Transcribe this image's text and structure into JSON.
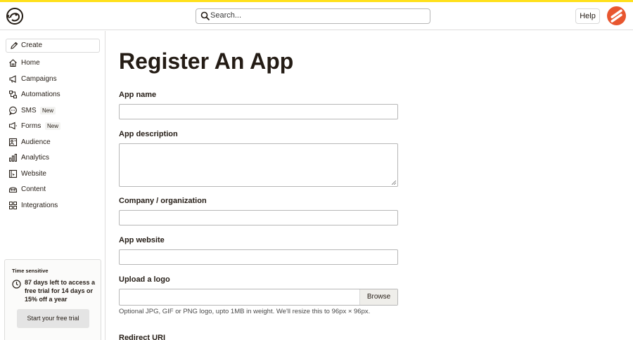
{
  "header": {
    "search_placeholder": "Search...",
    "help_label": "Help"
  },
  "sidebar": {
    "create_label": "Create",
    "items": [
      {
        "label": "Home",
        "icon": "home-icon"
      },
      {
        "label": "Campaigns",
        "icon": "megaphone-icon"
      },
      {
        "label": "Automations",
        "icon": "automations-icon"
      },
      {
        "label": "SMS",
        "icon": "chat-icon",
        "badge": "New"
      },
      {
        "label": "Forms",
        "icon": "form-icon",
        "badge": "New"
      },
      {
        "label": "Audience",
        "icon": "audience-icon"
      },
      {
        "label": "Analytics",
        "icon": "bar-chart-icon"
      },
      {
        "label": "Website",
        "icon": "website-icon"
      },
      {
        "label": "Content",
        "icon": "content-icon"
      },
      {
        "label": "Integrations",
        "icon": "grid-icon"
      }
    ],
    "trial": {
      "tag": "Time sensitive",
      "message": "87 days left to access a free trial for 14 days or 15% off a year",
      "cta": "Start your free trial"
    }
  },
  "main": {
    "title": "Register An App",
    "fields": {
      "app_name": {
        "label": "App name",
        "value": ""
      },
      "app_description": {
        "label": "App description",
        "value": ""
      },
      "company": {
        "label": "Company / organization",
        "value": ""
      },
      "app_website": {
        "label": "App website",
        "value": ""
      },
      "upload_logo": {
        "label": "Upload a logo",
        "browse_label": "Browse",
        "hint": "Optional JPG, GIF or PNG logo, upto 1MB in weight. We'll resize this to 96px × 96px."
      },
      "redirect_uri": {
        "label": "Redirect URI"
      }
    }
  },
  "colors": {
    "accent_stripe": "#ffe01b",
    "avatar": "#e8562f",
    "text": "#241c15"
  }
}
